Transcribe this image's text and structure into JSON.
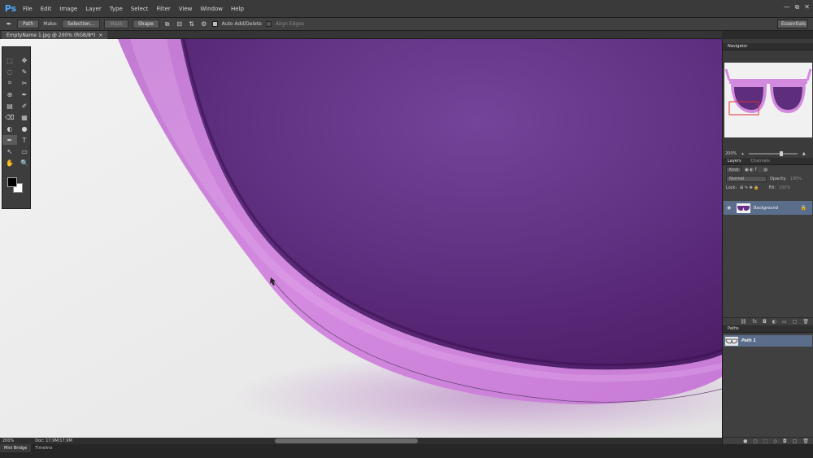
{
  "app": {
    "logo": "Ps"
  },
  "menu": [
    "File",
    "Edit",
    "Image",
    "Layer",
    "Type",
    "Select",
    "Filter",
    "View",
    "Window",
    "Help"
  ],
  "window_controls": [
    "—",
    "⧉",
    "✕"
  ],
  "options_bar": {
    "mode_select": "Path",
    "make_label": "Make:",
    "selection_btn": "Selection...",
    "mask_btn": "Mask",
    "shape_btn": "Shape",
    "auto_add_delete": "Auto Add/Delete",
    "align_edges": "Align Edges",
    "workspace": "Essentials"
  },
  "document_tab": {
    "title": "EmptyName 1.jpg @ 200% (RGB/8*)",
    "close": "×"
  },
  "tools": [
    "⬚",
    "✥",
    "◌",
    "✎",
    "⌗",
    "✂",
    "⊕",
    "✒",
    "▤",
    "✐",
    "⌫",
    "▦",
    "◐",
    "●",
    "✒",
    "T",
    "↖",
    "▭",
    "✋",
    "🔍"
  ],
  "status": {
    "zoom": "200%",
    "doc": "Doc: 17.9M/17.9M"
  },
  "bottom_tabs": [
    "Mini Bridge",
    "Timeline"
  ],
  "navigator": {
    "tab": "Navigator",
    "zoom": "200%"
  },
  "layers": {
    "tabs": [
      "Layers",
      "Channels"
    ],
    "filter_kind": "Kind",
    "blend_mode": "Normal",
    "opacity_label": "Opacity:",
    "opacity_value": "100%",
    "lock_label": "Lock:",
    "fill_label": "Fill:",
    "fill_value": "100%",
    "layer_name": "Background"
  },
  "paths": {
    "tab": "Paths",
    "path_name": "Path 1"
  },
  "colors": {
    "lens_dark": "#4f1f6a",
    "lens_mid": "#6a3a88",
    "frame": "#c676d6",
    "frame_light": "#dba1e6",
    "shadow": "#b06cc0"
  }
}
